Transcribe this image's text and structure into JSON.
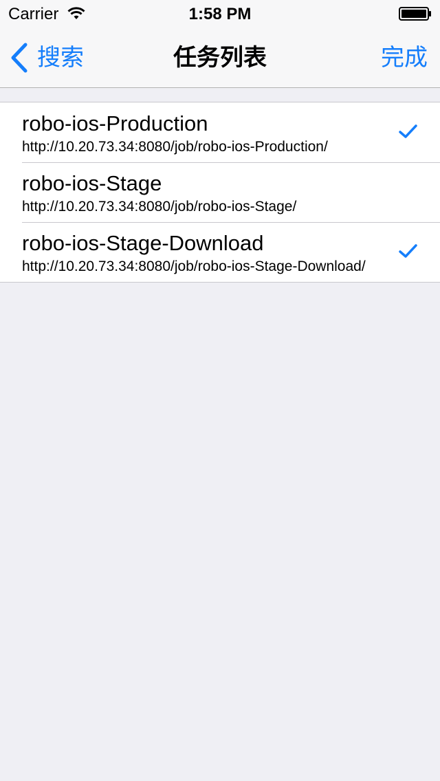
{
  "status_bar": {
    "carrier": "Carrier",
    "time": "1:58 PM"
  },
  "nav_bar": {
    "back_label": "搜索",
    "title": "任务列表",
    "done_label": "完成"
  },
  "jobs": [
    {
      "name": "robo-ios-Production",
      "url": "http://10.20.73.34:8080/job/robo-ios-Production/",
      "checked": true
    },
    {
      "name": "robo-ios-Stage",
      "url": "http://10.20.73.34:8080/job/robo-ios-Stage/",
      "checked": false
    },
    {
      "name": "robo-ios-Stage-Download",
      "url": "http://10.20.73.34:8080/job/robo-ios-Stage-Download/",
      "checked": true
    }
  ],
  "colors": {
    "tint": "#157efb",
    "background": "#efeff4"
  },
  "icons": {
    "wifi": "wifi-icon",
    "battery": "battery-icon",
    "back": "chevron-left-icon",
    "check": "checkmark-icon"
  }
}
